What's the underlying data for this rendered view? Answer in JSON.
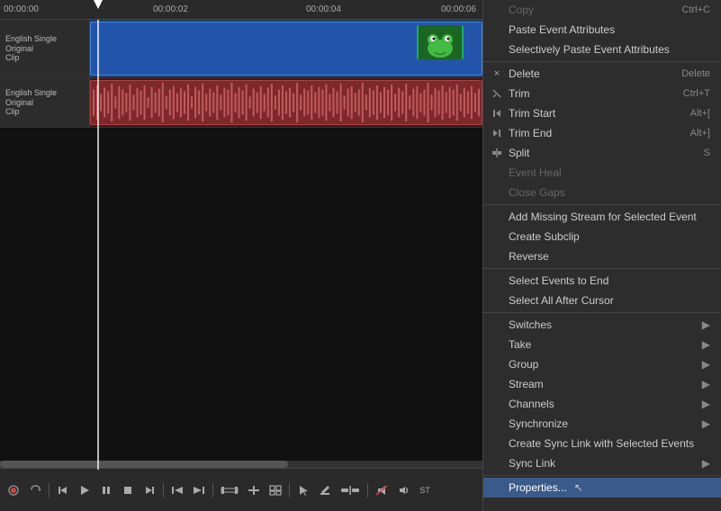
{
  "timeline": {
    "ruler": {
      "times": [
        "00:00:00",
        "00:00:02",
        "00:00:04",
        "00:00:06"
      ]
    },
    "tracks": [
      {
        "id": "video-track",
        "header": "English Single Original",
        "type": "video",
        "clip_label": "Clip"
      },
      {
        "id": "audio-track",
        "header": "English Single Original",
        "type": "audio",
        "clip_label": "Clip"
      }
    ]
  },
  "context_menu": {
    "items": [
      {
        "id": "copy",
        "label": "Copy",
        "shortcut": "Ctrl+C",
        "disabled": false,
        "has_icon": false
      },
      {
        "id": "paste-event-attributes",
        "label": "Paste Event Attributes",
        "shortcut": "",
        "disabled": false,
        "has_icon": false
      },
      {
        "id": "selectively-paste",
        "label": "Selectively Paste Event Attributes",
        "shortcut": "",
        "disabled": false,
        "has_icon": false
      },
      {
        "id": "sep1",
        "type": "separator"
      },
      {
        "id": "delete",
        "label": "Delete",
        "shortcut": "Delete",
        "disabled": false,
        "has_icon": true,
        "icon": "×"
      },
      {
        "id": "trim",
        "label": "Trim",
        "shortcut": "Ctrl+T",
        "disabled": false,
        "has_icon": true,
        "icon": ""
      },
      {
        "id": "trim-start",
        "label": "Trim Start",
        "shortcut": "Alt+[",
        "disabled": false,
        "has_icon": true,
        "icon": ""
      },
      {
        "id": "trim-end",
        "label": "Trim End",
        "shortcut": "Alt+]",
        "disabled": false,
        "has_icon": true,
        "icon": ""
      },
      {
        "id": "split",
        "label": "Split",
        "shortcut": "S",
        "disabled": false,
        "has_icon": true,
        "icon": ""
      },
      {
        "id": "event-heal",
        "label": "Event Heal",
        "shortcut": "",
        "disabled": true,
        "has_icon": false
      },
      {
        "id": "close-gaps",
        "label": "Close Gaps",
        "shortcut": "",
        "disabled": true,
        "has_icon": false
      },
      {
        "id": "sep2",
        "type": "separator"
      },
      {
        "id": "add-missing-stream",
        "label": "Add Missing Stream for Selected Event",
        "shortcut": "",
        "disabled": false,
        "has_icon": false
      },
      {
        "id": "create-subclip",
        "label": "Create Subclip",
        "shortcut": "",
        "disabled": false,
        "has_icon": false
      },
      {
        "id": "reverse",
        "label": "Reverse",
        "shortcut": "",
        "disabled": false,
        "has_icon": false
      },
      {
        "id": "sep3",
        "type": "separator"
      },
      {
        "id": "select-events-to-end",
        "label": "Select Events to End",
        "shortcut": "",
        "disabled": false,
        "has_icon": false
      },
      {
        "id": "select-all-after-cursor",
        "label": "Select All After Cursor",
        "shortcut": "",
        "disabled": false,
        "has_icon": false
      },
      {
        "id": "sep4",
        "type": "separator"
      },
      {
        "id": "switches",
        "label": "Switches",
        "shortcut": "",
        "disabled": false,
        "has_submenu": true
      },
      {
        "id": "take",
        "label": "Take",
        "shortcut": "",
        "disabled": false,
        "has_submenu": true
      },
      {
        "id": "group",
        "label": "Group",
        "shortcut": "",
        "disabled": false,
        "has_submenu": true
      },
      {
        "id": "stream",
        "label": "Stream",
        "shortcut": "",
        "disabled": false,
        "has_submenu": true
      },
      {
        "id": "channels",
        "label": "Channels",
        "shortcut": "",
        "disabled": false,
        "has_submenu": true
      },
      {
        "id": "synchronize",
        "label": "Synchronize",
        "shortcut": "",
        "disabled": false,
        "has_submenu": true
      },
      {
        "id": "create-sync-link",
        "label": "Create Sync Link with Selected Events",
        "shortcut": "",
        "disabled": false,
        "has_icon": false
      },
      {
        "id": "sync-link",
        "label": "Sync Link",
        "shortcut": "",
        "disabled": false,
        "has_submenu": true
      },
      {
        "id": "sep5",
        "type": "separator"
      },
      {
        "id": "properties",
        "label": "Properties...",
        "shortcut": "",
        "disabled": false,
        "highlighted": true
      }
    ]
  },
  "toolbar": {
    "buttons": [
      {
        "id": "record",
        "icon": "🎙",
        "label": "Record"
      },
      {
        "id": "loop",
        "icon": "↩",
        "label": "Loop"
      },
      {
        "id": "prev-event",
        "icon": "|◄",
        "label": "Prev"
      },
      {
        "id": "play",
        "icon": "▶",
        "label": "Play"
      },
      {
        "id": "pause",
        "icon": "⏸",
        "label": "Pause"
      },
      {
        "id": "stop",
        "icon": "■",
        "label": "Stop"
      },
      {
        "id": "next-event",
        "icon": "►|",
        "label": "Next"
      }
    ]
  }
}
